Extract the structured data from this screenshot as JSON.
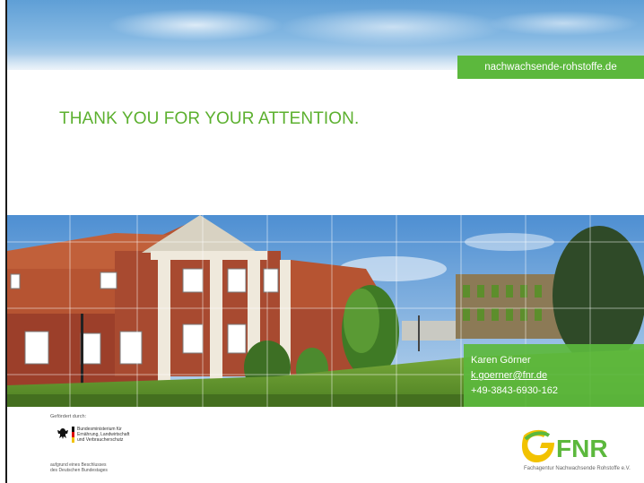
{
  "header": {
    "url_label": "nachwachsende-rohstoffe.de"
  },
  "main": {
    "title": "THANK YOU FOR YOUR ATTENTION."
  },
  "contact": {
    "name": "Karen Görner",
    "email": "k.goerner@fnr.de",
    "phone": "+49-3843-6930-162"
  },
  "footer": {
    "funder_label": "Gefördert durch:",
    "ministry_line1": "Bundesministerium für",
    "ministry_line2": "Ernährung, Landwirtschaft",
    "ministry_line3": "und Verbraucherschutz",
    "decision_line1": "aufgrund eines Beschlusses",
    "decision_line2": "des Deutschen Bundestages",
    "logo_text": "FNR",
    "logo_subtitle": "Fachagentur Nachwachsende Rohstoffe e.V."
  },
  "colors": {
    "brand_green": "#5cb83d",
    "title_green": "#5cb02f",
    "logo_yellow": "#f2c200"
  }
}
